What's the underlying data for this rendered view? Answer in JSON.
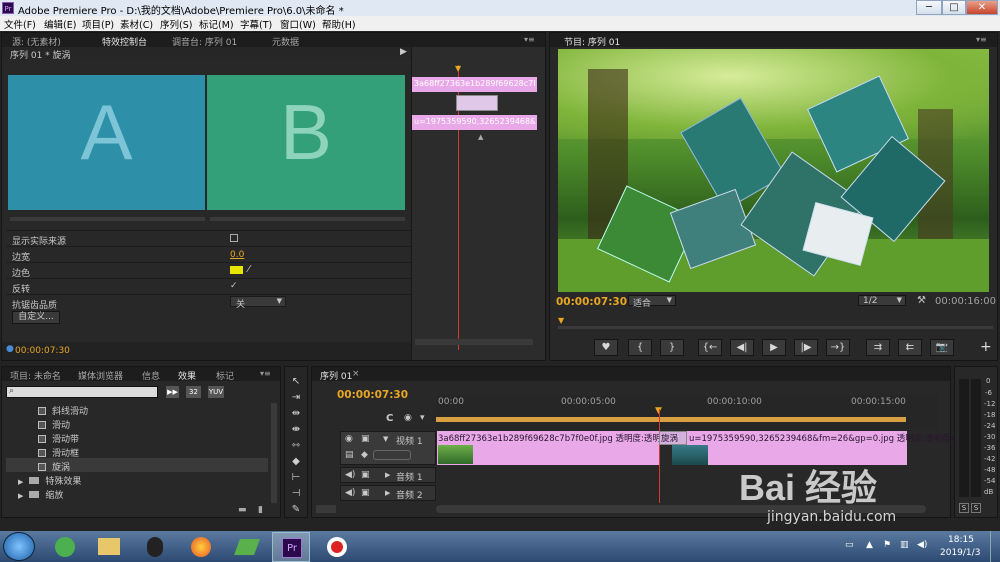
{
  "window": {
    "title": "Adobe Premiere Pro - D:\\我的文档\\Adobe\\Premiere Pro\\6.0\\未命名 *",
    "pr_badge": "Pr",
    "min": "─",
    "max": "□",
    "close": "✕"
  },
  "menu": [
    "文件(F)",
    "编辑(E)",
    "项目(P)",
    "素材(C)",
    "序列(S)",
    "标记(M)",
    "字幕(T)",
    "窗口(W)",
    "帮助(H)"
  ],
  "source_panel": {
    "tabs": [
      "源: (无素材)",
      "特效控制台",
      "调音台: 序列 01",
      "元数据"
    ],
    "menu_icon": "▾≡",
    "seq_title": "序列 01 * 旋涡",
    "play_arrow": "▶",
    "letter_a": "A",
    "letter_b": "B",
    "props": [
      {
        "label": "显示实际来源",
        "value": ""
      },
      {
        "label": "边宽",
        "value": "0.0"
      },
      {
        "label": "边色",
        "value": ""
      },
      {
        "label": "反转",
        "value": "✓"
      },
      {
        "label": "抗锯齿品质",
        "value": "关"
      }
    ],
    "custom_button": "自定义...",
    "timecode": "00:00:07:30",
    "mini_clip1": "3a68ff27363e1b289f69628c7b7f",
    "mini_clip2": "u=1975359590,3265239468&fm="
  },
  "program_panel": {
    "tab": "节目: 序列 01",
    "menu_icon": "▾≡",
    "timecode": "00:00:07:30",
    "fit": "适合",
    "ratio": "1/2",
    "duration": "00:00:16:00",
    "controls": [
      "♥",
      "{",
      "}",
      "{←",
      "◀|",
      "▶",
      "|▶",
      "→}",
      "⇉",
      "⇇",
      "📷"
    ],
    "add": "+"
  },
  "project_panel": {
    "tabs": [
      "项目: 未命名",
      "媒体浏览器",
      "信息",
      "效果",
      "标记"
    ],
    "menu_icon": "▾≡",
    "search_placeholder": "",
    "icons": [
      "32",
      "YUV"
    ],
    "items": [
      {
        "label": "斜线滑动",
        "type": "file"
      },
      {
        "label": "滑动",
        "type": "file"
      },
      {
        "label": "滑动带",
        "type": "file"
      },
      {
        "label": "滑动框",
        "type": "file"
      },
      {
        "label": "旋涡",
        "type": "file"
      },
      {
        "label": "特殊效果",
        "type": "folder"
      },
      {
        "label": "缩放",
        "type": "folder"
      }
    ]
  },
  "timeline": {
    "tab": "序列 01",
    "close": "×",
    "timecode": "00:00:07:30",
    "ruler": [
      "00:00",
      "00:00:05:00",
      "00:00:10:00",
      "00:00:15:00"
    ],
    "tracks": {
      "video": "视频 1",
      "audio1": "音频 1",
      "audio2": "音频 2"
    },
    "clip1_label": "3a68ff27363e1b289f69628c7b7f0e0f.jpg  透明度:透明度▾",
    "transition_label": "旋涡",
    "clip2_label": "u=1975359590,3265239468&fm=26&gp=0.jpg  透明度:透明度▾",
    "meter_labels": [
      "0",
      "-6",
      "-12",
      "-18",
      "-24",
      "-30",
      "-36",
      "-42",
      "-48",
      "-54",
      "dB"
    ],
    "solo": [
      "S",
      "S"
    ]
  },
  "taskbar": {
    "time": "18:15",
    "date": "2019/1/3",
    "pr": "Pr"
  },
  "watermark": {
    "text": "Bai 经验",
    "url": "jingyan.baidu.com"
  },
  "colors": {
    "accent": "#e8a623",
    "clip": "#e9a9e9",
    "tile_a": "#2d8fa8",
    "tile_b": "#33a07a",
    "playhead": "#d63a2a"
  }
}
